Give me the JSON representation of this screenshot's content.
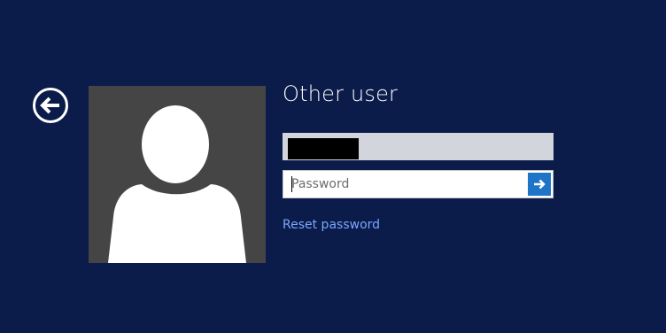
{
  "login": {
    "title": "Other user",
    "password_placeholder": "Password",
    "reset_link": "Reset password"
  },
  "icons": {
    "back": "back-arrow-icon",
    "submit": "submit-arrow-icon",
    "avatar": "user-silhouette-icon"
  },
  "colors": {
    "background": "#0b1c4a",
    "avatar_bg": "#454545",
    "submit_bg": "#1e74c6",
    "link": "#7ca6ff",
    "username_field_bg": "#d2d5db"
  }
}
